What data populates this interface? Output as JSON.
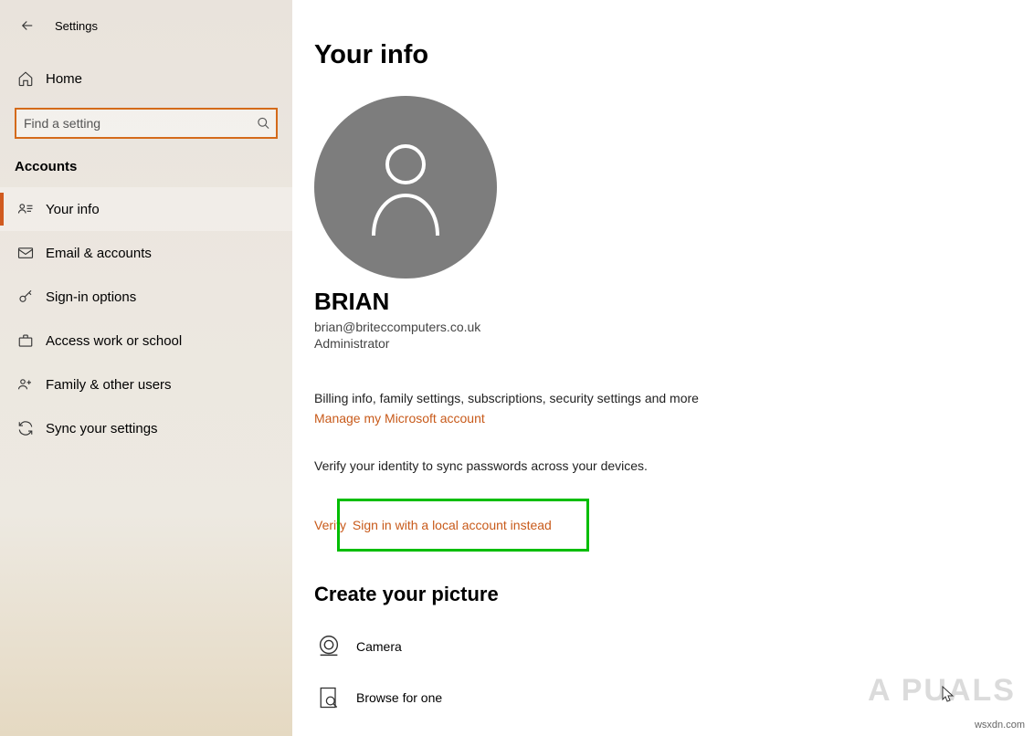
{
  "header": {
    "settings": "Settings"
  },
  "sidebar": {
    "home": "Home",
    "search_placeholder": "Find a setting",
    "category": "Accounts",
    "items": [
      {
        "label": "Your info"
      },
      {
        "label": "Email & accounts"
      },
      {
        "label": "Sign-in options"
      },
      {
        "label": "Access work or school"
      },
      {
        "label": "Family & other users"
      },
      {
        "label": "Sync your settings"
      }
    ]
  },
  "main": {
    "title": "Your info",
    "user_name": "BRIAN",
    "user_email": "brian@briteccomputers.co.uk",
    "user_role": "Administrator",
    "billing_text": "Billing info, family settings, subscriptions, security settings and more",
    "manage_link": "Manage my Microsoft account",
    "verify_text": "Verify your identity to sync passwords across your devices.",
    "verify_link": "Verify",
    "signin_local": "Sign in with a local account instead",
    "picture_title": "Create your picture",
    "camera_label": "Camera",
    "browse_label": "Browse for one"
  },
  "footer": {
    "watermark": "A  PUALS",
    "source": "wsxdn.com"
  }
}
